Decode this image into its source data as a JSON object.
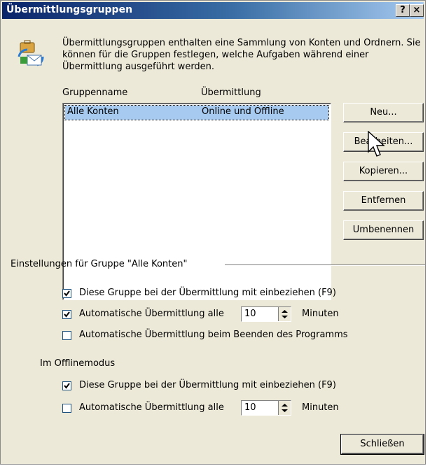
{
  "window": {
    "title": "Übermittlungsgruppen",
    "help_label": "?",
    "close_label": "×"
  },
  "intro_text": "Übermittlungsgruppen enthalten eine Sammlung von Konten und Ordnern. Sie können für die Gruppen festlegen, welche Aufgaben während einer Übermittlung ausgeführt werden.",
  "list": {
    "columns": [
      "Gruppenname",
      "Übermittlung"
    ],
    "rows": [
      {
        "name": "Alle Konten",
        "mode": "Online und Offline"
      }
    ]
  },
  "buttons": {
    "new": "Neu...",
    "edit": "Bearbeiten...",
    "copy": "Kopieren...",
    "remove": "Entfernen",
    "rename": "Umbenennen",
    "close": "Schließen"
  },
  "settings": {
    "group_label": "Einstellungen für Gruppe \"Alle Konten\"",
    "online": {
      "include": {
        "label": "Diese Gruppe bei der Übermittlung mit einbeziehen (F9)",
        "checked": true
      },
      "auto": {
        "label": "Automatische Übermittlung alle",
        "checked": true,
        "value": "10",
        "unit": "Minuten"
      },
      "on_exit": {
        "label": "Automatische Übermittlung beim Beenden des Programms",
        "checked": false
      }
    },
    "offline_label": "Im Offlinemodus",
    "offline": {
      "include": {
        "label": "Diese Gruppe bei der Übermittlung mit einbeziehen (F9)",
        "checked": true
      },
      "auto": {
        "label": "Automatische Übermittlung alle",
        "checked": false,
        "value": "10",
        "unit": "Minuten"
      }
    }
  },
  "colors": {
    "titlebar_start": "#0a246a",
    "titlebar_end": "#a6caf0",
    "selection": "#a6caf0",
    "dialog_bg": "#ece9d8"
  },
  "icons": {
    "dialog_icon": "send-receive-groups-icon",
    "cursor": "mouse-pointer-icon"
  }
}
